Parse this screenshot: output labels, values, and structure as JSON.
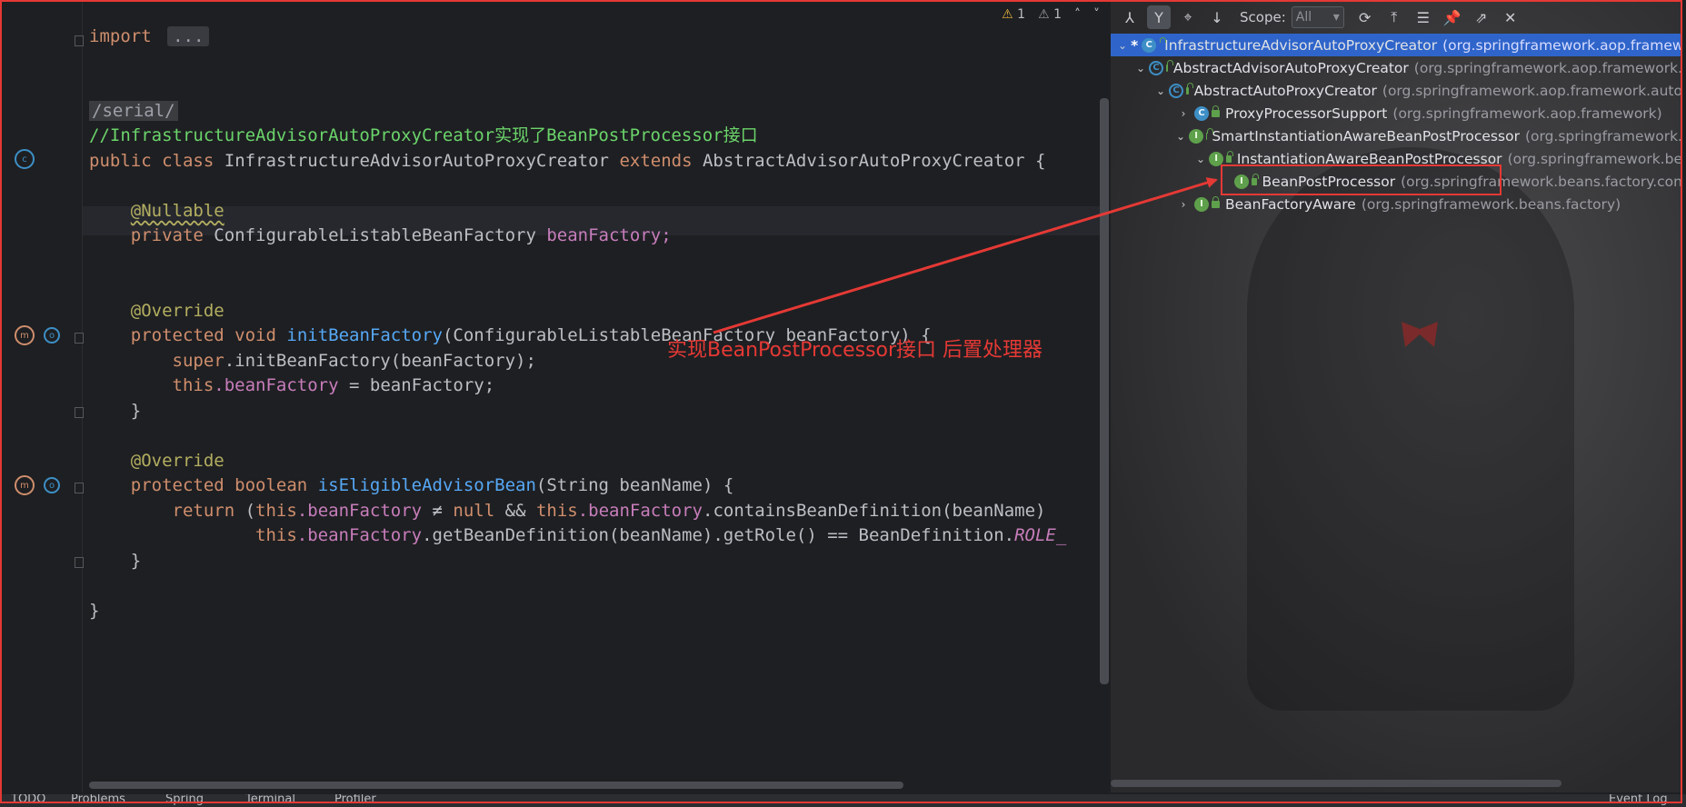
{
  "editor": {
    "warnings": [
      "1",
      "1"
    ],
    "lines": {
      "import_kw": "import",
      "import_fold": "...",
      "serial": "/serial/",
      "comment": "//InfrastructureAdvisorAutoProxyCreator实现了BeanPostProcessor接口",
      "class_public": "public",
      "class_kw": "class",
      "class_name": "InfrastructureAdvisorAutoProxyCreator",
      "extends_kw": "extends",
      "parent": "AbstractAdvisorAutoProxyCreator {",
      "nullable": "@Nullable",
      "private_kw": "private",
      "field_type": "ConfigurableListableBeanFactory",
      "field_name": "beanFactory;",
      "override1": "@Override",
      "protected1": "protected",
      "void_kw": "void",
      "method1": "initBeanFactory",
      "method1_params": "(ConfigurableListableBeanFactory beanFactory) {",
      "super_kw": "super",
      "super_call": ".initBeanFactory(beanFactory);",
      "this_kw": "this",
      "this_field": ".beanFactory",
      "assign": " = beanFactory;",
      "close1": "}",
      "override2": "@Override",
      "protected2": "protected",
      "boolean_kw": "boolean",
      "method2": "isEligibleAdvisorBean",
      "method2_params": "(String beanName) {",
      "return_kw": "return",
      "ret_open": " (",
      "ret_this1": "this",
      "ret_field1": ".beanFactory",
      "ret_ne": " ≠ ",
      "null_kw": "null",
      "ret_and": " && ",
      "ret_this2": "this",
      "ret_field2": ".beanFactory",
      "ret_contains": ".containsBeanDefinition(beanName)",
      "cont_this": "this",
      "cont_field": ".beanFactory",
      "cont_rest": ".getBeanDefinition(beanName).getRole() == BeanDefinition.",
      "cont_role": "ROLE_",
      "close2": "}",
      "close_class": "}"
    }
  },
  "hierarchy": {
    "scope_label": "Scope:",
    "scope_value": "All",
    "rows": [
      {
        "name": "InfrastructureAdvisorAutoProxyCreator",
        "pkg": "(org.springframework.aop.framew"
      },
      {
        "name": "AbstractAdvisorAutoProxyCreator",
        "pkg": "(org.springframework.aop.framework."
      },
      {
        "name": "AbstractAutoProxyCreator",
        "pkg": "(org.springframework.aop.framework.auto"
      },
      {
        "name": "ProxyProcessorSupport",
        "pkg": "(org.springframework.aop.framework)"
      },
      {
        "name": "SmartInstantiationAwareBeanPostProcessor",
        "pkg": "(org.springframework."
      },
      {
        "name": "InstantiationAwareBeanPostProcessor",
        "pkg": "(org.springframework.be"
      },
      {
        "name": "BeanPostProcessor",
        "pkg": "(org.springframework.beans.factory.con"
      },
      {
        "name": "BeanFactoryAware",
        "pkg": "(org.springframework.beans.factory)"
      }
    ]
  },
  "annotation": "实现BeanPostProcessor接口 后置处理器",
  "bottom_tabs": [
    "TODO",
    "Problems",
    "Spring",
    "Terminal",
    "Profiler",
    "Event Log"
  ],
  "colors": {
    "accent_red": "#e53935",
    "selection": "#2f65ca"
  },
  "icons": [
    "warning-icon",
    "class-icon",
    "interface-icon",
    "abstract-class-icon",
    "lock-icon",
    "chevron-icon",
    "refresh-icon",
    "pin-icon",
    "close-icon"
  ]
}
